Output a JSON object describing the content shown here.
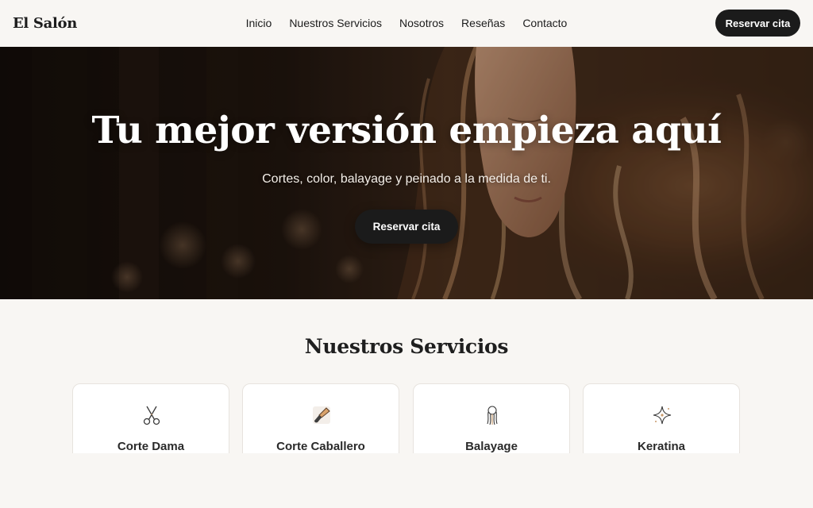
{
  "header": {
    "logo": "El Salón",
    "nav": [
      "Inicio",
      "Nuestros Servicios",
      "Nosotros",
      "Reseñas",
      "Contacto"
    ],
    "cta_label": "Reservar cita"
  },
  "hero": {
    "title": "Tu mejor versión empieza aquí",
    "subtitle": "Cortes, color, balayage y peinado a la medida de ti.",
    "cta_label": "Reservar cita"
  },
  "services": {
    "title": "Nuestros Servicios",
    "items": [
      {
        "name": "Corte Dama",
        "icon": "scissors-icon"
      },
      {
        "name": "Corte Caballero",
        "icon": "brush-icon"
      },
      {
        "name": "Balayage",
        "icon": "hair-strands-icon"
      },
      {
        "name": "Keratina",
        "icon": "sparkle-icon"
      }
    ]
  },
  "colors": {
    "background": "#f8f6f3",
    "button": "#1b1b1b",
    "text": "#1c1c1c",
    "card": "#ffffff"
  }
}
